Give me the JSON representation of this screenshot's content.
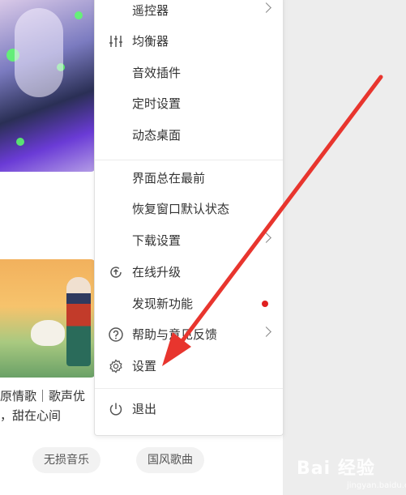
{
  "background": {
    "panel_color": "#ededed",
    "menu_bg": "#ffffff"
  },
  "content": {
    "desc_line1": "原情歌｜歌声优",
    "desc_line2": "，甜在心间",
    "tags": [
      "无损音乐",
      "国风歌曲"
    ]
  },
  "menu": {
    "items": [
      {
        "label": "遥控器",
        "icon": "",
        "submenu": true
      },
      {
        "label": "均衡器",
        "icon": "equalizer-icon",
        "submenu": false
      },
      {
        "label": "音效插件",
        "icon": "",
        "submenu": false
      },
      {
        "label": "定时设置",
        "icon": "",
        "submenu": false
      },
      {
        "label": "动态桌面",
        "icon": "",
        "submenu": false
      },
      {
        "label": "界面总在最前",
        "icon": "",
        "submenu": false
      },
      {
        "label": "恢复窗口默认状态",
        "icon": "",
        "submenu": false
      },
      {
        "label": "下载设置",
        "icon": "",
        "submenu": true
      },
      {
        "label": "在线升级",
        "icon": "upgrade-icon",
        "submenu": false
      },
      {
        "label": "发现新功能",
        "icon": "",
        "submenu": false,
        "badge": "new-dot"
      },
      {
        "label": "帮助与意见反馈",
        "icon": "help-icon",
        "submenu": true
      },
      {
        "label": "设置",
        "icon": "gear-icon",
        "submenu": false
      },
      {
        "label": "退出",
        "icon": "power-icon",
        "submenu": false
      }
    ],
    "accent_color": "#e02020"
  },
  "annotation": {
    "arrow_color": "#e8352e"
  },
  "watermark": {
    "text": "Bai 经验",
    "sub": "jingyan.baidu.com"
  }
}
